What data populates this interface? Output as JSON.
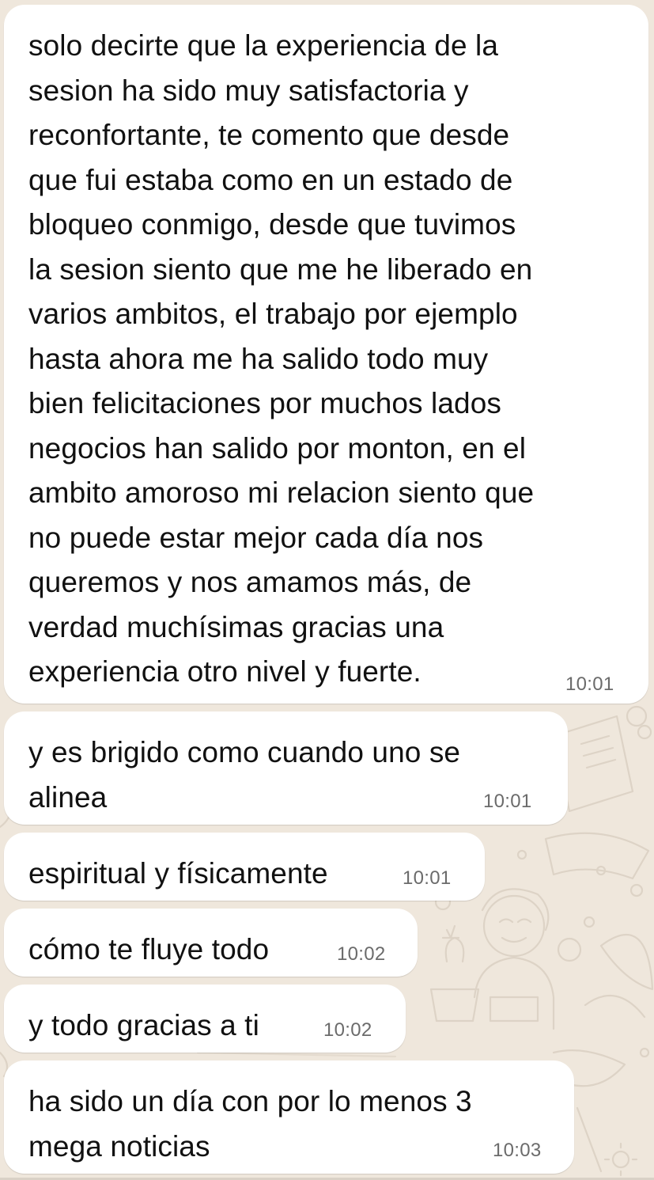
{
  "chat": {
    "messages": [
      {
        "text": "solo decirte que la experiencia de la\nsesion ha sido muy satisfactoria y\nreconfortante, te comento que desde\nque fui estaba como en un estado de\nbloqueo conmigo, desde que tuvimos\nla sesion siento que me he liberado en\nvarios ambitos, el trabajo por ejemplo\nhasta ahora me ha salido todo muy\nbien felicitaciones por muchos lados\nnegocios han salido por monton, en el\nambito amoroso mi relacion siento que\nno puede estar mejor cada día nos\nqueremos y nos amamos más, de\nverdad muchísimas gracias una\nexperiencia otro nivel y fuerte.",
        "time": "10:01"
      },
      {
        "text": "y es brigido como cuando uno se\nalinea",
        "time": "10:01"
      },
      {
        "text": "espiritual y físicamente",
        "time": "10:01"
      },
      {
        "text": "cómo te fluye todo",
        "time": "10:02"
      },
      {
        "text": "y todo gracias a ti",
        "time": "10:02"
      },
      {
        "text": "ha sido un día con por lo menos 3\nmega noticias",
        "time": "10:03"
      }
    ]
  },
  "colors": {
    "wallpaper": "#efe7dc",
    "bubble": "#ffffff",
    "text": "#111111",
    "timestamp": "#6b6b6b"
  }
}
